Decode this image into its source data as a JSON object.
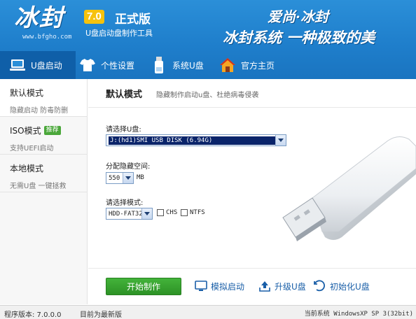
{
  "header": {
    "logo_text": "冰封",
    "logo_url": "www.bfgho.com",
    "version": "7.0",
    "edition": "正式版",
    "subtitle": "U盘启动盘制作工具",
    "slogan_line1": "爱尚·冰封",
    "slogan_line2": "冰封系统 一种极致的美"
  },
  "nav": {
    "items": [
      {
        "label": "U盘启动",
        "icon": "laptop-icon"
      },
      {
        "label": "个性设置",
        "icon": "shirt-icon"
      },
      {
        "label": "系统U盘",
        "icon": "usb-drive-icon"
      },
      {
        "label": "官方主页",
        "icon": "home-icon"
      }
    ]
  },
  "sidebar": {
    "items": [
      {
        "title": "默认模式",
        "sub": "隐藏启动 防毒防删",
        "active": true
      },
      {
        "title": "ISO模式",
        "tag": "推荐",
        "sub": "支持UEFI启动"
      },
      {
        "title": "本地模式",
        "sub": "无需U盘 一键拯救"
      }
    ]
  },
  "main": {
    "title": "默认模式",
    "description": "隐藏制作启动u盘、杜绝病毒侵袭",
    "disk_label": "请选择U盘:",
    "disk_value": "J:(hd1)SMI USB DISK (6.94G)",
    "hidden_label": "分配隐藏空间:",
    "hidden_value": "550",
    "hidden_unit": "MB",
    "mode_label": "请选择模式:",
    "mode_value": "HDD-FAT32",
    "chs_label": "CHS",
    "ntfs_label": "NTFS",
    "start_button": "开始制作",
    "simulate": "模拟启动",
    "upgrade": "升级U盘",
    "initialize": "初始化U盘"
  },
  "status": {
    "version": "程序版本: 7.0.0.0",
    "latest": "目前为最新版",
    "system": "当前系统 WindowsXP SP 3(32bit)"
  },
  "colors": {
    "header_blue": "#1f7fcc",
    "nav_active": "#0f5fa8",
    "badge_yellow": "#f6c20c",
    "start_green": "#2d9226",
    "link_blue": "#1a5fa8"
  }
}
